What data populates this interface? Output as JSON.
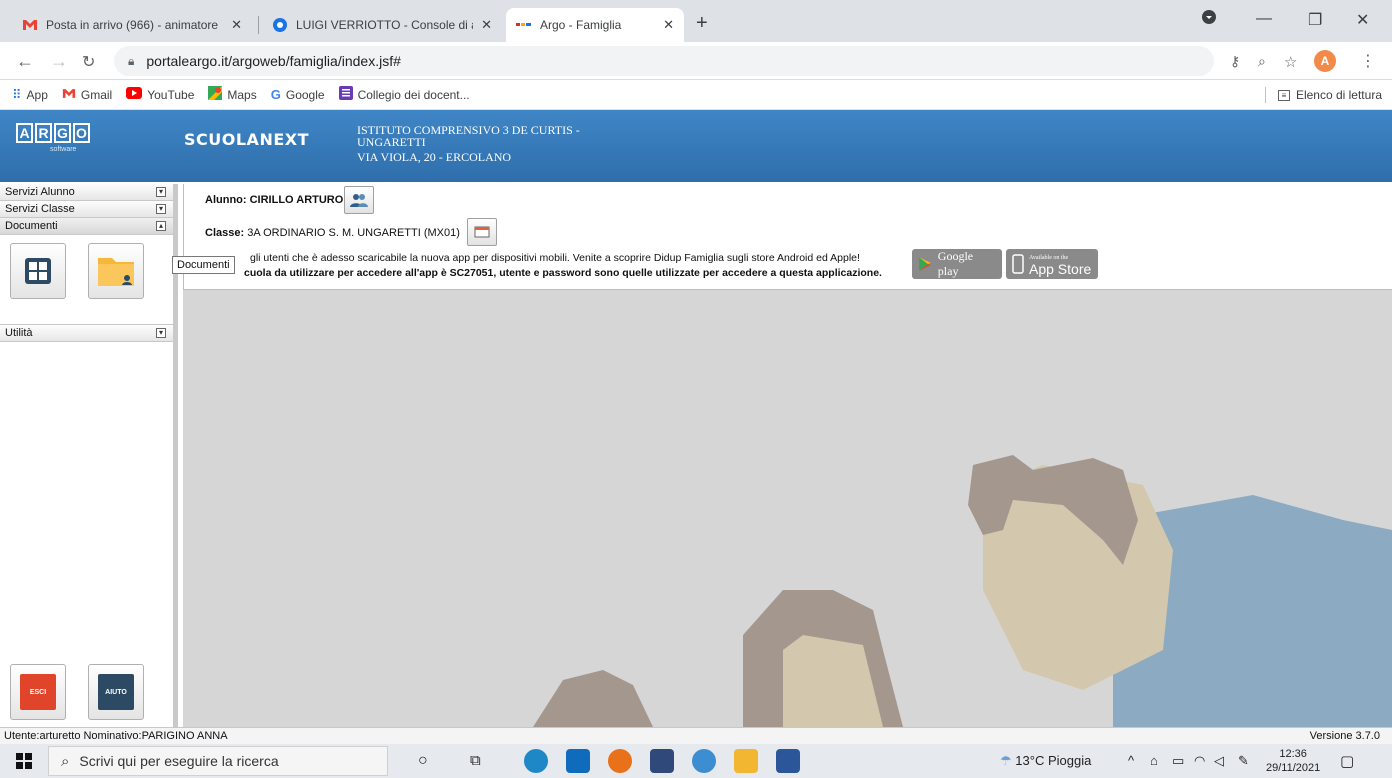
{
  "browser": {
    "tabs": [
      {
        "title": "Posta in arrivo (966) - animatore",
        "favicon": "gmail-icon"
      },
      {
        "title": "LUIGI VERRIOTTO - Console di am",
        "favicon": "console-icon"
      },
      {
        "title": "Argo - Famiglia",
        "favicon": "argo-icon"
      }
    ],
    "new_tab": "+",
    "url": "portaleargo.it/argoweb/famiglia/index.jsf#",
    "profile_initial": "A",
    "bookmarks": [
      {
        "label": "App",
        "icon": "apps-grid-icon"
      },
      {
        "label": "Gmail",
        "icon": "gmail-icon"
      },
      {
        "label": "YouTube",
        "icon": "youtube-icon"
      },
      {
        "label": "Maps",
        "icon": "maps-icon"
      },
      {
        "label": "Google",
        "icon": "google-icon"
      },
      {
        "label": "Collegio dei docent...",
        "icon": "forms-icon"
      }
    ],
    "reading_list": "Elenco di lettura"
  },
  "header": {
    "logo_letters": [
      "A",
      "R",
      "G",
      "O"
    ],
    "logo_sub": "software",
    "product": "SCUOLANEXT",
    "institute_line1": "ISTITUTO COMPRENSIVO 3 DE CURTIS -",
    "institute_line2": "UNGARETTI",
    "institute_line3": "VIA VIOLA, 20 - ERCOLANO",
    "color_primary": "#3a7fc1"
  },
  "sidebar": {
    "sections": [
      {
        "label": "Servizi Alunno"
      },
      {
        "label": "Servizi Classe"
      },
      {
        "label": "Documenti"
      }
    ],
    "utilita": "Utilità",
    "tooltip": "Documenti",
    "exit_label": "ESCI",
    "help_label": "AIUTO"
  },
  "info": {
    "alunno_label": "Alunno:",
    "alunno_value": "CIRILLO ARTURO",
    "classe_label": "Classe:",
    "classe_value": "3A ORDINARIO S. M. UNGARETTI (MX01)",
    "notice_line1": "gli utenti che è adesso scaricabile la nuova app per dispositivi mobili. Venite a scoprire Didup Famiglia sugli store Android ed Apple!",
    "notice_line2": "cuola da utilizzare per accedere all'app è SC27051, utente e password sono quelle utilizzate per accedere a questa applicazione.",
    "google_play": "Google play",
    "app_store_top": "Available on the",
    "app_store": "App Store"
  },
  "status": {
    "user": "Utente:arturetto Nominativo:PARIGINO ANNA",
    "version": "Versione 3.7.0"
  },
  "taskbar": {
    "search_placeholder": "Scrivi qui per eseguire la ricerca",
    "weather": "13°C Pioggia",
    "time": "12:36",
    "date": "29/11/2021"
  }
}
